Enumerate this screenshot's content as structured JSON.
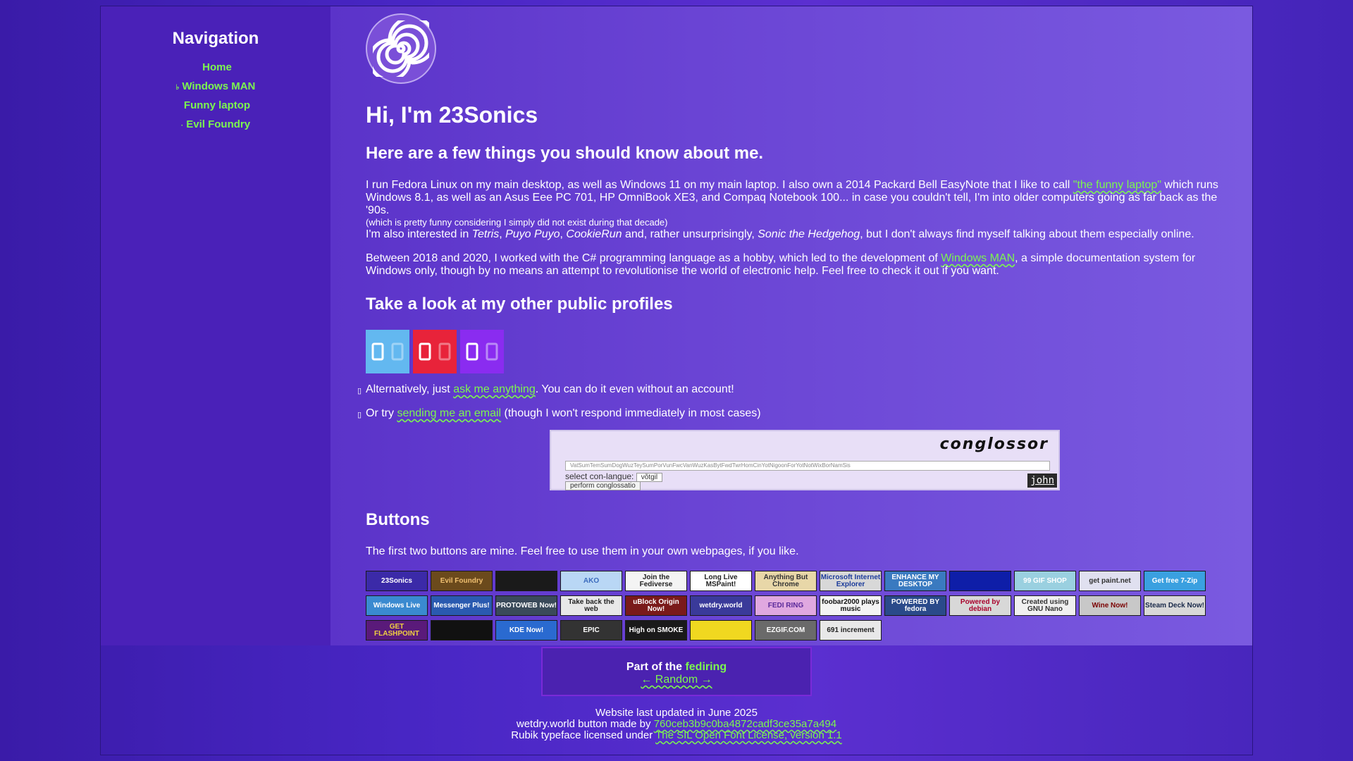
{
  "nav": {
    "title": "Navigation",
    "items": [
      {
        "icon": "",
        "label": "Home"
      },
      {
        "icon": "♭",
        "label": "Windows MAN"
      },
      {
        "icon": "",
        "label": "Funny laptop"
      },
      {
        "icon": "·",
        "label": "Evil Foundry"
      }
    ]
  },
  "intro": {
    "heading": "Hi, I'm 23Sonics",
    "subheading": "Here are a few things you should know about me.",
    "p1_a": "I run Fedora Linux on my main desktop, as well as Windows 11 on my main laptop. I also own a 2014 Packard Bell EasyNote that I like to call ",
    "p1_link": "\"the funny laptop\"",
    "p1_b": " which runs Windows 8.1, as well as an Asus Eee PC 701, HP OmniBook XE3, and Compaq Notebook 100... in case you couldn't tell, I'm into older computers going as far back as the '90s.",
    "p1_small": "(which is pretty funny considering I simply did not exist during that decade)",
    "p2_a": "I'm also interested in ",
    "p2_tetris": "Tetris",
    "p2_sep1": ", ",
    "p2_puyo": "Puyo Puyo",
    "p2_sep2": ", ",
    "p2_cookie": "CookieRun",
    "p2_b": " and, rather unsurprisingly, ",
    "p2_sonic": "Sonic the Hedgehog",
    "p2_c": ", but I don't always find myself talking about them especially online.",
    "p3_a": "Between 2018 and 2020, I worked with the C# programming language as a hobby, which led to the development of ",
    "p3_link": "Windows MAN",
    "p3_b": ", a simple documentation system for Windows only, though by no means an attempt to revolutionise the world of electronic help. Feel free to check it out if you want."
  },
  "profiles": {
    "heading": "Take a look at my other public profiles",
    "items": [
      {
        "name": "bluesky",
        "color": "#63b8f0"
      },
      {
        "name": "youtube",
        "color": "#e8233a"
      },
      {
        "name": "twitch",
        "color": "#8a2cf0"
      }
    ]
  },
  "contact": {
    "ask_a": "Alternatively, just ",
    "ask_link": "ask me anything",
    "ask_b": ". You can do it even without an account!",
    "email_a": "Or try ",
    "email_link": "sending me an email",
    "email_b": " (though I won't respond immediately in most cases)"
  },
  "conglossor": {
    "title": "conglossor",
    "input_text": "VatSumTemSumDogWuzTeySumPorVunFwcVanWuzKasBytFwdTwrHomCinYotNigoonForYotNotWixBorNamSis",
    "select_label": "select con-langue:",
    "select_value": "võtgil",
    "button": "perform conglossatio",
    "badge": "john"
  },
  "buttons": {
    "heading": "Buttons",
    "desc": "The first two buttons are mine. Feel free to use them in your own webpages, if you like.",
    "rows": [
      [
        {
          "label": "23Sonics",
          "bg": "#3b2aa8",
          "fg": "#ffffff"
        },
        {
          "label": "Evil Foundry",
          "bg": "#6b4a1c",
          "fg": "#f0c070"
        },
        {
          "label": "",
          "bg": "#1a1a1a",
          "fg": "#4cf07a"
        },
        {
          "label": "AKO",
          "bg": "#b9d7f5",
          "fg": "#3b6bbd"
        },
        {
          "label": "Join the Fediverse",
          "bg": "#f4f4f4",
          "fg": "#222222"
        },
        {
          "label": "Long Live MSPaint!",
          "bg": "#ffffff",
          "fg": "#222222"
        },
        {
          "label": "Anything But Chrome",
          "bg": "#e8d7a8",
          "fg": "#333333"
        },
        {
          "label": "Microsoft Internet Explorer",
          "bg": "#d8d8d8",
          "fg": "#1a3a9a"
        },
        {
          "label": "ENHANCE MY DESKTOP",
          "bg": "#3a7ac0",
          "fg": "#ffffff"
        },
        {
          "label": "",
          "bg": "#0e1ea8",
          "fg": "#ffffff"
        },
        {
          "label": "99 GIF SHOP",
          "bg": "#9ad0e0",
          "fg": "#ffffff"
        },
        {
          "label": "get paint.net",
          "bg": "#e0e0f0",
          "fg": "#333333"
        },
        {
          "label": "Get free 7-Zip",
          "bg": "#3aa0e0",
          "fg": "#ffffff"
        }
      ],
      [
        {
          "label": "Windows Live",
          "bg": "#3a8ad0",
          "fg": "#ffffff"
        },
        {
          "label": "Messenger Plus!",
          "bg": "#2a5ab0",
          "fg": "#ffffff"
        },
        {
          "label": "PROTOWEB Now!",
          "bg": "#3a4a5a",
          "fg": "#ffffff"
        },
        {
          "label": "Take back the web",
          "bg": "#e8e8e8",
          "fg": "#222222"
        },
        {
          "label": "uBlock Origin Now!",
          "bg": "#7a1a1a",
          "fg": "#ffffff"
        },
        {
          "label": "wetdry.world",
          "bg": "#3a3a9a",
          "fg": "#ffffff"
        },
        {
          "label": "FEDI RING",
          "bg": "#e0a8e0",
          "fg": "#5a2a9a"
        },
        {
          "label": "foobar2000 plays music",
          "bg": "#f4f4f4",
          "fg": "#111111"
        },
        {
          "label": "POWERED BY fedora",
          "bg": "#2a4a8a",
          "fg": "#ffffff"
        },
        {
          "label": "Powered by debian",
          "bg": "#d8d8d8",
          "fg": "#a8002a"
        },
        {
          "label": "Created using GNU Nano",
          "bg": "#f0f0f0",
          "fg": "#333333"
        },
        {
          "label": "Wine Now!",
          "bg": "#c8c8c8",
          "fg": "#7a0000"
        },
        {
          "label": "Steam Deck Now!",
          "bg": "#d8d8d8",
          "fg": "#1a2a4a"
        }
      ],
      [
        {
          "label": "GET FLASHPOINT",
          "bg": "#5a1a7a",
          "fg": "#f0d040"
        },
        {
          "label": "",
          "bg": "#111111",
          "fg": "#f0e040"
        },
        {
          "label": "KDE Now!",
          "bg": "#2a6ad0",
          "fg": "#ffffff"
        },
        {
          "label": "EPIC",
          "bg": "#333333",
          "fg": "#ffffff"
        },
        {
          "label": "High on SMOKE",
          "bg": "#1a1a1a",
          "fg": "#ffffff"
        },
        {
          "label": "",
          "bg": "#f0d820",
          "fg": "#333333"
        },
        {
          "label": "EZGIF.COM",
          "bg": "#6a6a6a",
          "fg": "#ffffff"
        },
        {
          "label": "691 increment",
          "bg": "#e8e8e8",
          "fg": "#222222"
        }
      ]
    ]
  },
  "webring": {
    "prefix": "Part of the ",
    "name": "fediring",
    "nav": "← Random →"
  },
  "footer": {
    "updated": "Website last updated in June 2025",
    "button_a": "wetdry.world button made by ",
    "button_link": "760ceb3b9c0ba4872cadf3ce35a7a494",
    "font_a": "Rubik typeface licensed under ",
    "font_link": "The SIL Open Font License, version 1.1"
  }
}
